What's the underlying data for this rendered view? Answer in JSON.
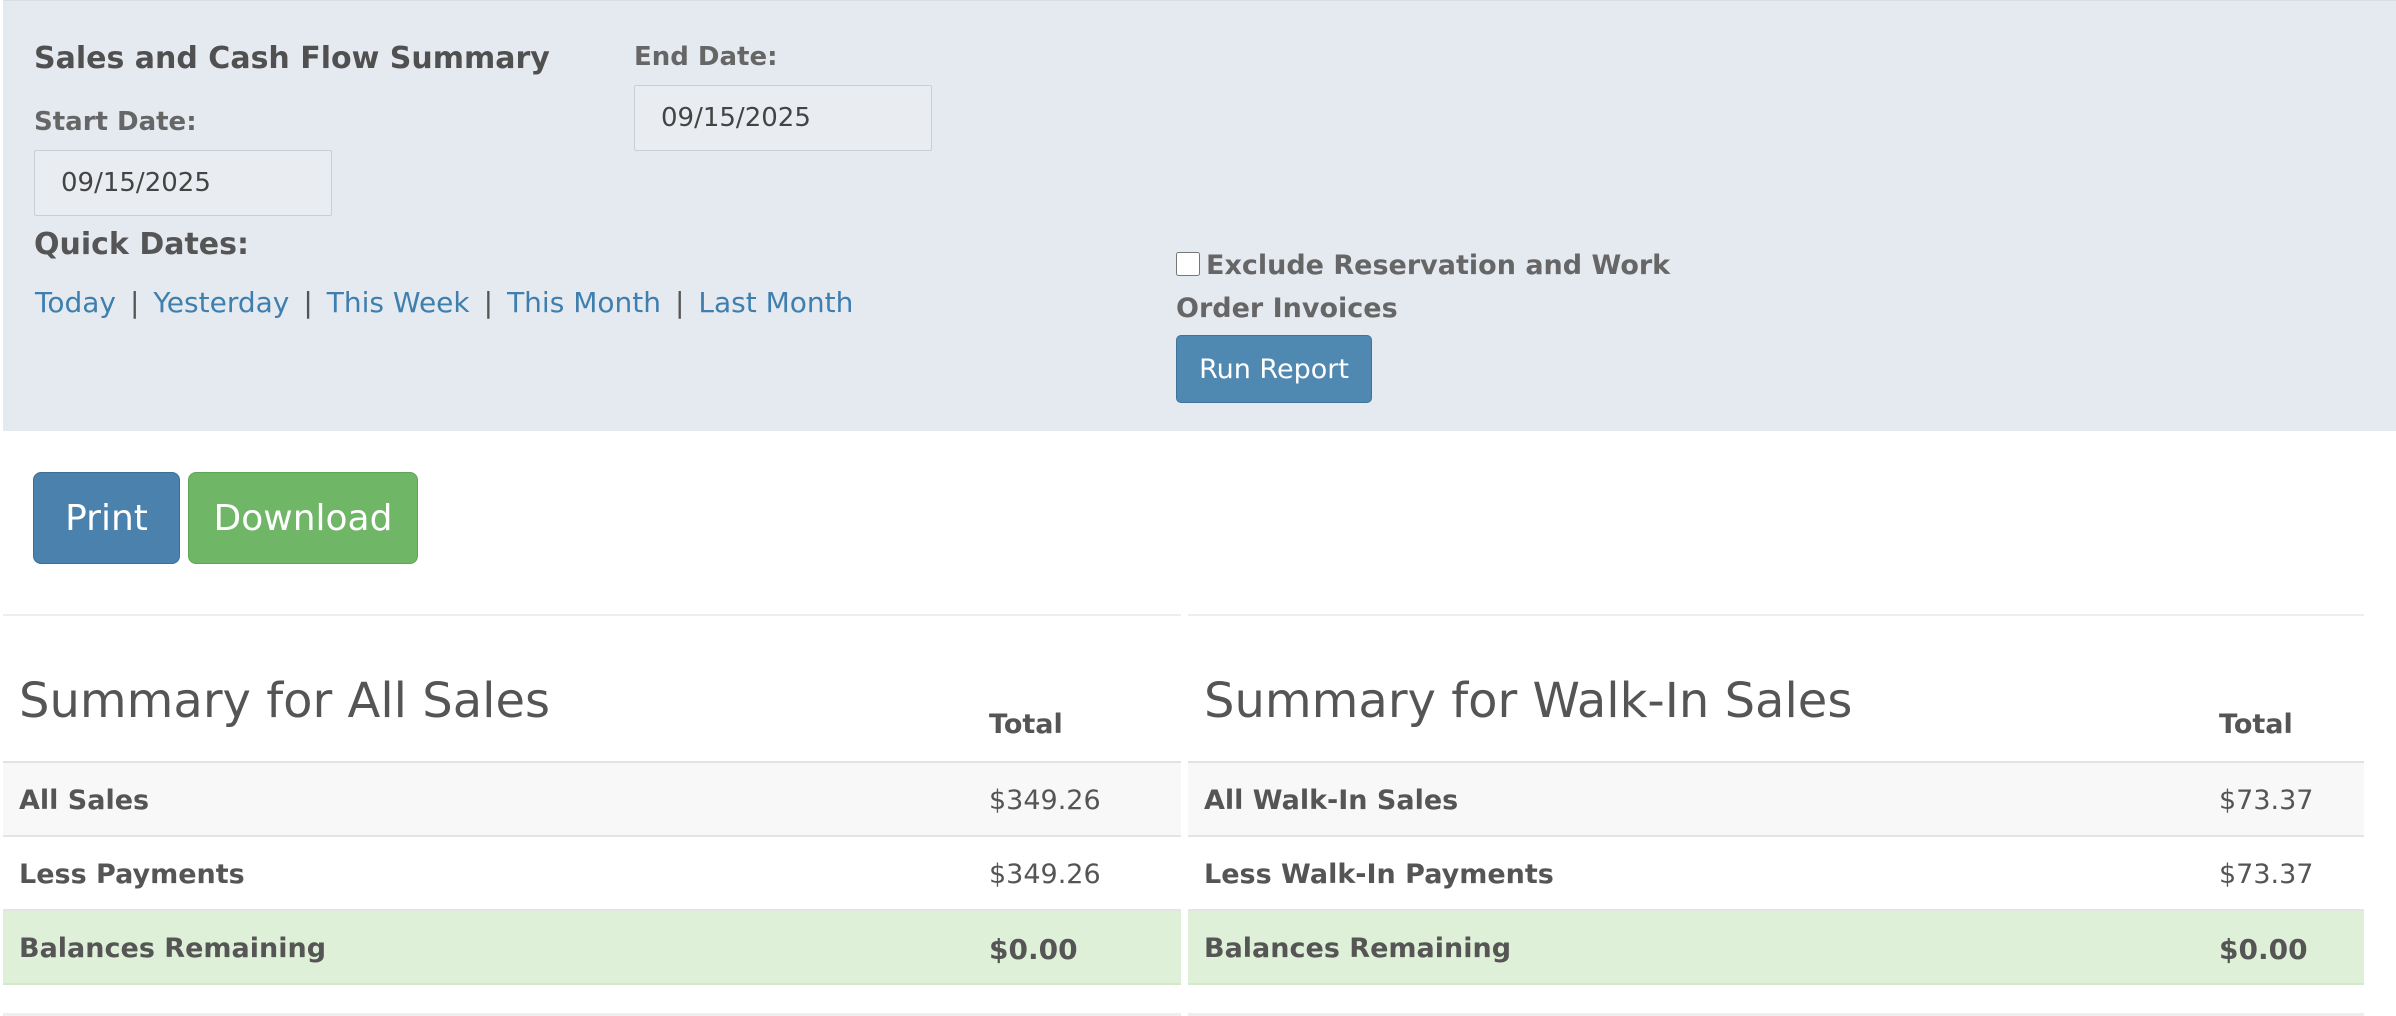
{
  "filters": {
    "title": "Sales and Cash Flow Summary",
    "start_label": "Start Date:",
    "start_value": "09/15/2025",
    "end_label": "End Date:",
    "end_value": "09/15/2025",
    "quick_dates_label": "Quick Dates:",
    "quick_dates": [
      "Today",
      "Yesterday",
      "This Week",
      "This Month",
      "Last Month"
    ],
    "separator": "|",
    "exclude_label": "Exclude Reservation and Work Order Invoices",
    "exclude_checked": false,
    "run_label": "Run Report"
  },
  "actions": {
    "print_label": "Print",
    "download_label": "Download"
  },
  "summary_all": {
    "title": "Summary for All Sales",
    "col_header": "Total",
    "rows": [
      {
        "label": "All Sales",
        "total": "$349.26"
      },
      {
        "label": "Less Payments",
        "total": "$349.26"
      },
      {
        "label": "Balances Remaining",
        "total": "$0.00"
      }
    ]
  },
  "summary_walkin": {
    "title": "Summary for Walk-In Sales",
    "col_header": "Total",
    "rows": [
      {
        "label": "All Walk-In Sales",
        "total": "$73.37"
      },
      {
        "label": "Less Walk-In Payments",
        "total": "$73.37"
      },
      {
        "label": "Balances Remaining",
        "total": "$0.00"
      }
    ]
  },
  "colors": {
    "panel_bg": "#e5e9f0",
    "link": "#3f7fae",
    "primary_button": "#4f88b1",
    "success_button": "#6fb667",
    "success_row": "#dff0d8"
  }
}
